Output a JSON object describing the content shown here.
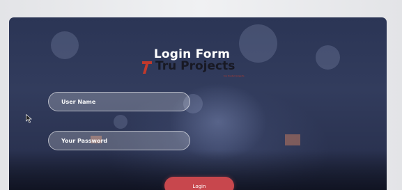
{
  "login_form": {
    "title": "Login Form",
    "username_placeholder": "User Name",
    "password_placeholder": "Your Password",
    "login_button": "Login"
  },
  "watermark": {
    "brand": "Tru Projects",
    "tagline": "top trusted projects"
  },
  "colors": {
    "button": "#c8474d",
    "card_background": "#2f3959",
    "logo_red": "#c0392b"
  },
  "icons": {
    "cursor": "mouse-pointer-icon",
    "logo": "tru-projects-logo-icon"
  }
}
